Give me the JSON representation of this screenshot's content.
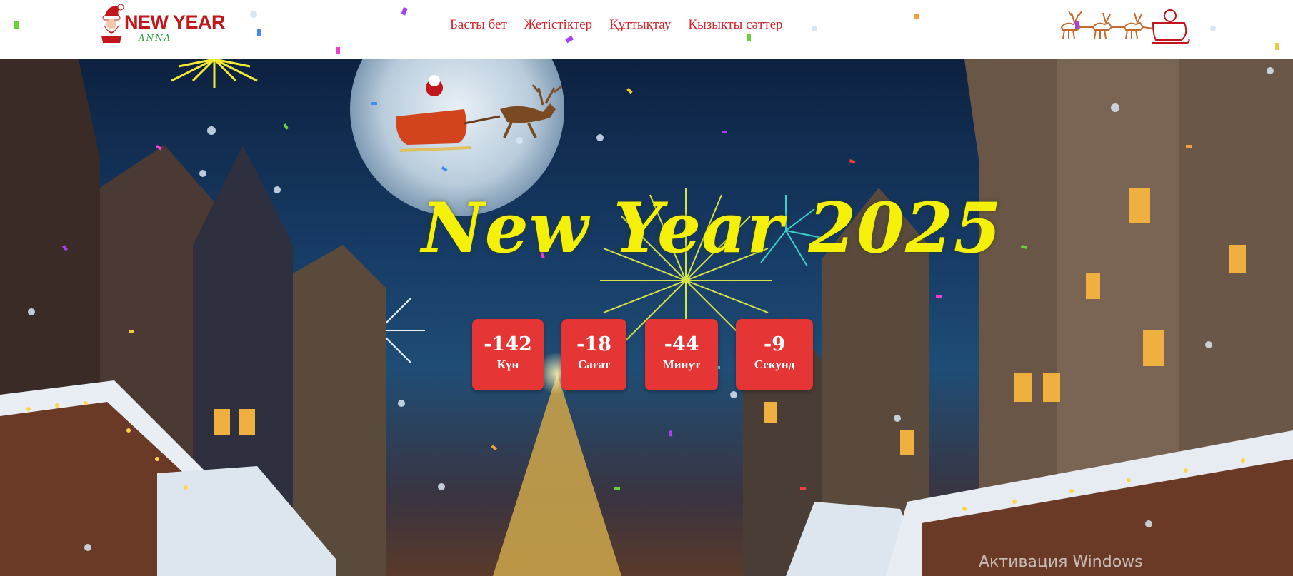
{
  "header": {
    "logo_text": "NEW YEAR",
    "logo_sub": "ANNA",
    "nav": [
      {
        "label": "Басты бет"
      },
      {
        "label": "Жетістіктер"
      },
      {
        "label": "Құттықтау"
      },
      {
        "label": "Қызықты сәттер"
      }
    ]
  },
  "hero": {
    "title": "New Year 2025",
    "countdown": [
      {
        "value": "-142",
        "label": "Күн"
      },
      {
        "value": "-18",
        "label": "Сағат"
      },
      {
        "value": "-44",
        "label": "Минут"
      },
      {
        "value": "-9",
        "label": "Секунд"
      }
    ]
  },
  "os_watermark": "Активация Windows",
  "colors": {
    "nav_text": "#d9232b",
    "countdown_bg": "#e53535",
    "title": "#f4f00a"
  },
  "icons": [
    "santa-logo-icon",
    "reindeer-sleigh-icon"
  ]
}
